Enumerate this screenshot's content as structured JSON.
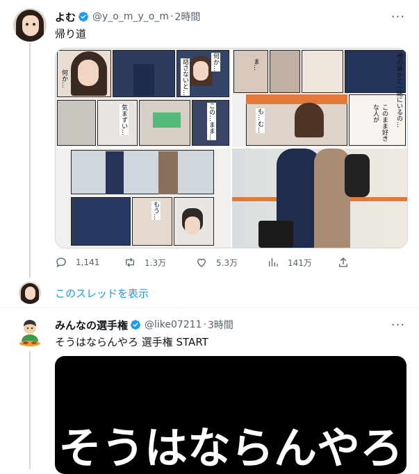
{
  "tweets": [
    {
      "name": "よむ",
      "handle": "@y_o_m_y_o_m",
      "separator": "·",
      "time": "2時間",
      "text": "帰り道",
      "more": "···",
      "actions": {
        "reply": "1,141",
        "retweet": "1.3万",
        "like": "5.3万",
        "views": "141万"
      },
      "comic_lines": [
        "何か…",
        "話さないと…",
        "何か…",
        "ま…",
        "…ぅ…",
        "この…まま…",
        "気まずい…",
        "この…ままでも…",
        "ちょ…",
        "この人…で…",
        "もう…",
        "でも…",
        "このまま好きな人が",
        "他の誰かと一緒にいるの…",
        "も…む…"
      ]
    },
    {
      "name": "みんなの選手権",
      "handle": "@like07211",
      "separator": "·",
      "time": "3時間",
      "text": "そうはならんやろ 選手権 START",
      "more": "···",
      "media_text": "そうはならんやろ"
    }
  ],
  "thread_link": "このスレッドを表示",
  "colors": {
    "link": "#1d9bf0",
    "secondary": "#536471",
    "verified": "#1d9bf0",
    "line": "#cfd9de"
  }
}
